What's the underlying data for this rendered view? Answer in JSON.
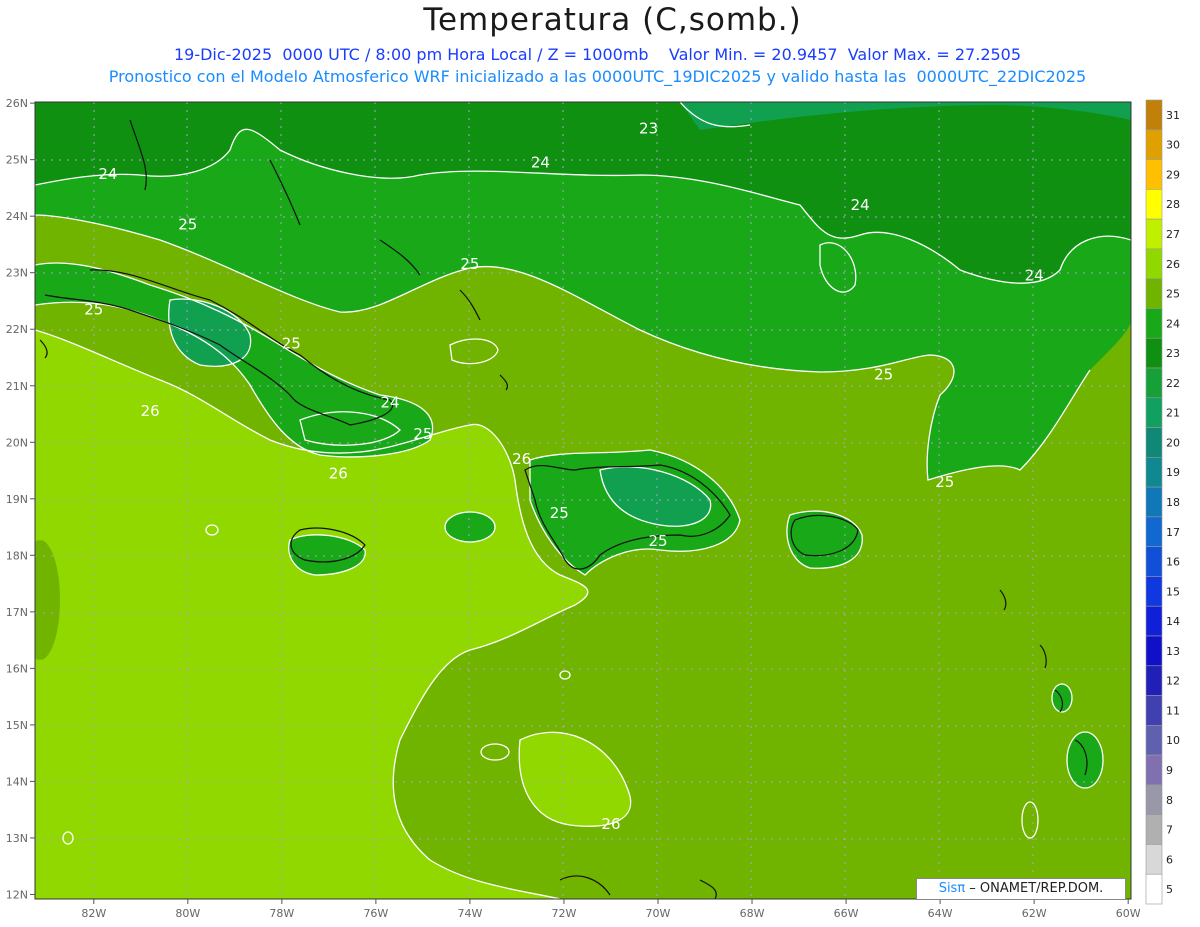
{
  "header": {
    "title": "Temperatura (C,somb.)",
    "line1": "19-Dic-2025  0000 UTC / 8:00 pm Hora Local / Z = 1000mb    Valor Min. = 20.9457  Valor Max. = 27.2505",
    "line2": "Pronostico con el Modelo Atmosferico WRF inicializado a las 0000UTC_19DIC2025 y valido hasta las  0000UTC_22DIC2025"
  },
  "credit": {
    "brand": "Sisπ",
    "text": " – ONAMET/REP.DOM."
  },
  "axes": {
    "lon_labels": [
      "82W",
      "80W",
      "78W",
      "76W",
      "74W",
      "72W",
      "70W",
      "68W",
      "66W",
      "64W",
      "62W",
      "60W"
    ],
    "lat_labels": [
      "26N",
      "25N",
      "24N",
      "23N",
      "22N",
      "21N",
      "20N",
      "19N",
      "18N",
      "17N",
      "16N",
      "15N",
      "14N",
      "13N",
      "12N"
    ]
  },
  "colorbar": {
    "levels": [
      "31",
      "30",
      "29",
      "28",
      "27",
      "26",
      "25",
      "24",
      "23",
      "22",
      "21",
      "20",
      "19",
      "18",
      "17",
      "16",
      "15",
      "14",
      "13",
      "12",
      "11",
      "10",
      "9",
      "8",
      "7",
      "6",
      "5"
    ],
    "colors": [
      "#c0800a",
      "#e0a000",
      "#ffc000",
      "#ffff00",
      "#c0f000",
      "#90d800",
      "#70b400",
      "#18a818",
      "#109010",
      "#18a038",
      "#10a060",
      "#108878",
      "#108890",
      "#1078b8",
      "#1068d0",
      "#1050d8",
      "#1038e0",
      "#1020d8",
      "#1010c8",
      "#2020b8",
      "#4040b0",
      "#6060b0",
      "#8070b0",
      "#9898a8",
      "#b0b0b0",
      "#d8d8d8",
      "#ffffff"
    ]
  },
  "contour_labels": [
    {
      "text": "23",
      "lon": -70.2,
      "lat": 25.55
    },
    {
      "text": "24",
      "lon": -72.5,
      "lat": 24.95
    },
    {
      "text": "24",
      "lon": -81.7,
      "lat": 24.75
    },
    {
      "text": "24",
      "lon": -65.7,
      "lat": 24.2
    },
    {
      "text": "24",
      "lon": -62.0,
      "lat": 22.95
    },
    {
      "text": "25",
      "lon": -80.0,
      "lat": 23.85
    },
    {
      "text": "25",
      "lon": -74.0,
      "lat": 23.15
    },
    {
      "text": "25",
      "lon": -82.0,
      "lat": 22.35
    },
    {
      "text": "25",
      "lon": -77.8,
      "lat": 21.75
    },
    {
      "text": "25",
      "lon": -75.0,
      "lat": 20.15
    },
    {
      "text": "25",
      "lon": -65.2,
      "lat": 21.2
    },
    {
      "text": "25",
      "lon": -63.9,
      "lat": 19.3
    },
    {
      "text": "25",
      "lon": -72.1,
      "lat": 18.75
    },
    {
      "text": "25",
      "lon": -70.0,
      "lat": 18.25
    },
    {
      "text": "24",
      "lon": -75.7,
      "lat": 20.7
    },
    {
      "text": "26",
      "lon": -80.8,
      "lat": 20.55
    },
    {
      "text": "26",
      "lon": -76.8,
      "lat": 19.45
    },
    {
      "text": "26",
      "lon": -72.9,
      "lat": 19.7
    },
    {
      "text": "26",
      "lon": -71.0,
      "lat": 13.25
    }
  ]
}
